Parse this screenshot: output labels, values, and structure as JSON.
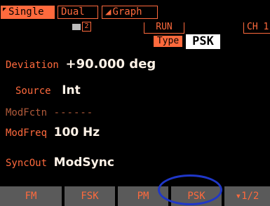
{
  "tabs": {
    "single": "Single",
    "dual": "Dual",
    "graph_glyph": "◢",
    "graph": "Graph"
  },
  "channel_indicator": "2",
  "status": {
    "run": "RUN",
    "channel": "CH 1",
    "type_label": "Type",
    "type_value": "PSK"
  },
  "params": {
    "deviation": {
      "label": "Deviation",
      "value": "+90.000 deg"
    },
    "source": {
      "label": "Source",
      "value": "Int"
    },
    "modfctn": {
      "label": "ModFctn",
      "value": "------"
    },
    "modfreq": {
      "label": "ModFreq",
      "value": "100 Hz"
    },
    "syncout": {
      "label": "SyncOut",
      "value": "ModSync"
    }
  },
  "softkeys": {
    "fm": "FM",
    "fsk": "FSK",
    "pm": "PM",
    "psk": "PSK",
    "page": "▾1/2"
  },
  "colors": {
    "accent": "#ff6a3d",
    "softkey_bg": "#5a5a5a",
    "highlight_ring": "#1f37c8"
  }
}
